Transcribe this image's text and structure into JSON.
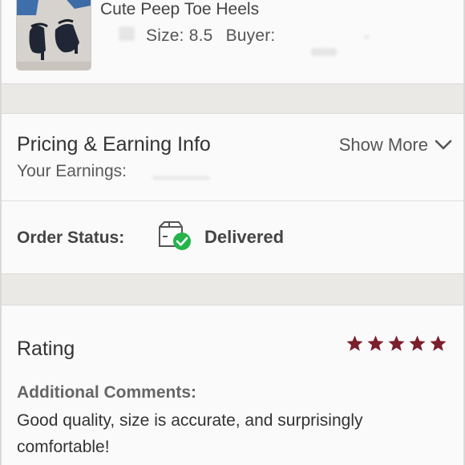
{
  "product": {
    "title": "Cute Peep Toe Heels",
    "size": "Size: 8.5",
    "buyer_label": "Buyer:"
  },
  "pricing": {
    "title": "Pricing & Earning Info",
    "show_more": "Show More",
    "earnings_label": "Your Earnings:"
  },
  "order_status": {
    "label": "Order Status:",
    "value": "Delivered",
    "icon": "package-delivered-icon"
  },
  "rating": {
    "title": "Rating",
    "stars": 5,
    "star_color": "#7c1f2c",
    "comments_label": "Additional Comments:",
    "comments": "Good quality, size is accurate, and surprisingly comfortable!"
  },
  "colors": {
    "background": "#fafafb",
    "separator_band": "#ebe9e6",
    "check_green": "#25b34b"
  }
}
